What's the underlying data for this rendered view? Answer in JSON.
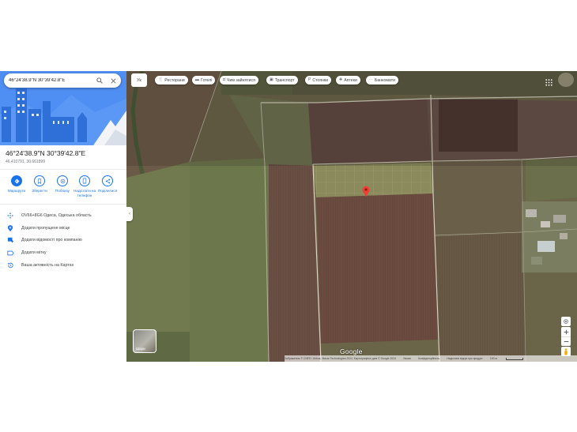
{
  "search": {
    "value": "46°24'38.9\"N 30°39'42.8\"E"
  },
  "place": {
    "title": "46°24'38.9\"N 30°39'42.8\"E",
    "decimal": "46.410791, 30.661899"
  },
  "actions": [
    {
      "label": "Маршрути",
      "icon": "directions-icon"
    },
    {
      "label": "Зберегти",
      "icon": "bookmark-icon"
    },
    {
      "label": "Поблизу",
      "icon": "nearby-icon"
    },
    {
      "label": "Надіслати на телефон",
      "icon": "phone-icon"
    },
    {
      "label": "Поділитися",
      "icon": "share-icon"
    }
  ],
  "info_rows": [
    {
      "text": "OV66+8G6 Одеса, Одеська область",
      "icon": "plus-code-icon"
    },
    {
      "text": "Додати пропущене місце",
      "icon": "add-place-icon"
    },
    {
      "text": "Додати відомості про компанію",
      "icon": "business-icon"
    },
    {
      "text": "Додати мітку",
      "icon": "label-icon"
    },
    {
      "text": "Ваша активність на Картах",
      "icon": "history-icon"
    }
  ],
  "language_button": "Ук",
  "chips": [
    {
      "label": "Ресторани",
      "icon": "restaurant-icon",
      "glyph": "🍴"
    },
    {
      "label": "Готелі",
      "icon": "hotel-icon",
      "glyph": "▬"
    },
    {
      "label": "Чим зайнятися",
      "icon": "things-to-do-icon",
      "glyph": "◘"
    },
    {
      "label": "Транспорт",
      "icon": "transit-icon",
      "glyph": "▣"
    },
    {
      "label": "Стоянки",
      "icon": "parking-icon",
      "glyph": "P"
    },
    {
      "label": "Аптеки",
      "icon": "pharmacy-icon",
      "glyph": "✚"
    },
    {
      "label": "Банкомати",
      "icon": "atm-icon",
      "glyph": "⋯"
    }
  ],
  "layers_label": "Шари",
  "map_logo": "Google",
  "attribution": {
    "imagery": "Зображення © CNES / Airbus, Maxar Technologies 2024, Картографічні дані © Google 2024",
    "terms": "Умови",
    "privacy": "Конфіденційність",
    "feedback": "Надіслати відгук про продукт",
    "scale": "100 м"
  },
  "colors": {
    "accent": "#1a73e8",
    "pin": "#ea4335"
  }
}
